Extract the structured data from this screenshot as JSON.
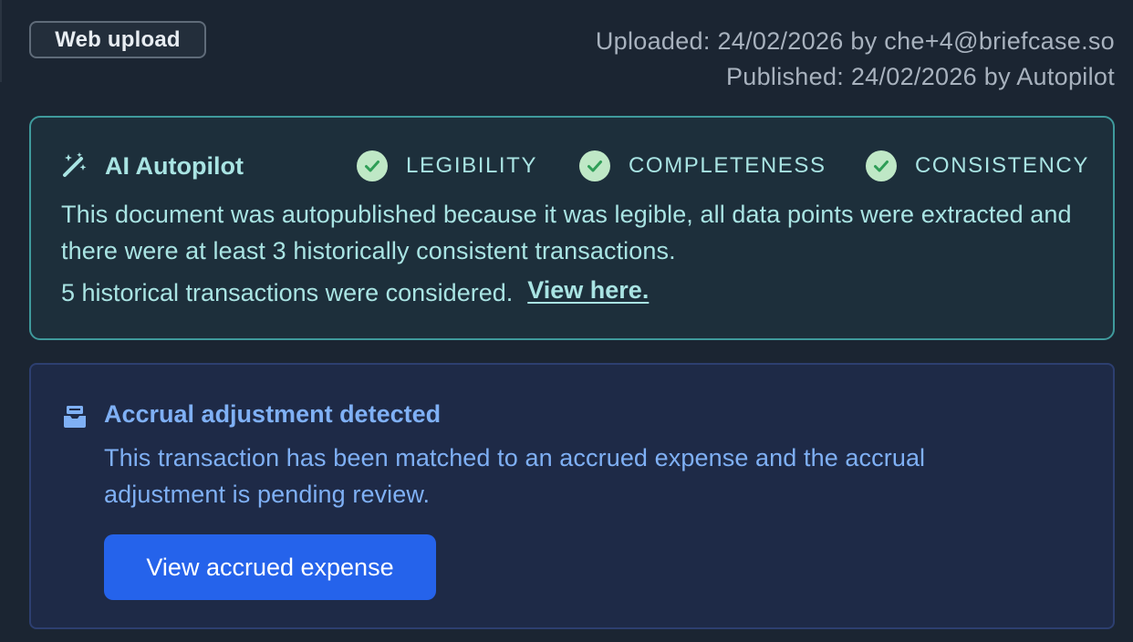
{
  "source_tag": "Web upload",
  "meta": {
    "uploaded": "Uploaded: 24/02/2026 by che+4@briefcase.so",
    "published": "Published: 24/02/2026 by Autopilot"
  },
  "autopilot": {
    "title": "AI Autopilot",
    "icon": "magic-wand-icon",
    "checks": [
      {
        "label": "LEGIBILITY",
        "icon": "check-circle-icon"
      },
      {
        "label": "COMPLETENESS",
        "icon": "check-circle-icon"
      },
      {
        "label": "CONSISTENCY",
        "icon": "check-circle-icon"
      }
    ],
    "body": "This document was autopublished because it was legible, all data points were extracted and there were at least 3 historically consistent transactions.",
    "considered": "5 historical transactions were considered.",
    "link_label": "View here."
  },
  "accrual": {
    "icon": "inbox-tray-icon",
    "title": "Accrual adjustment detected",
    "body": "This transaction has been matched to an accrued expense and the accrual adjustment is pending review.",
    "button_label": "View accrued expense"
  },
  "colors": {
    "background": "#1b2532",
    "autopilot_border": "#3f9a9c",
    "autopilot_text": "#a9e4e3",
    "check_fill": "#bfe8c6",
    "check_mark": "#2f9e57",
    "accrual_bg": "#1e2a47",
    "accrual_text": "#7fb0f5",
    "button_bg": "#2563eb"
  }
}
